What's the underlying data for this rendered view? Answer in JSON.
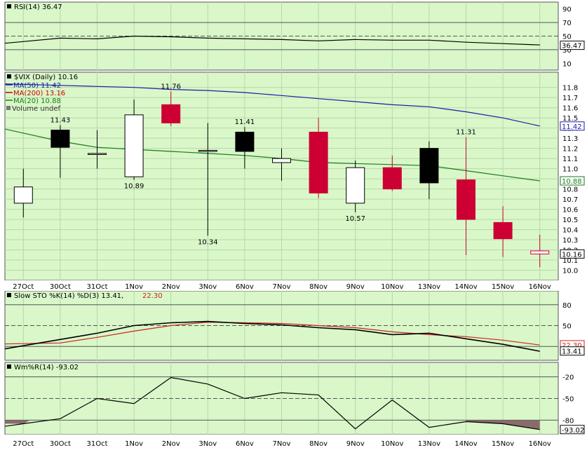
{
  "chart_data": [
    {
      "type": "line",
      "panel": "rsi",
      "title": "RSI(14) 36.47",
      "x": [
        "27Oct",
        "30Oct",
        "31Oct",
        "1Nov",
        "2Nov",
        "3Nov",
        "6Nov",
        "7Nov",
        "8Nov",
        "9Nov",
        "10Nov",
        "13Nov",
        "14Nov",
        "15Nov",
        "16Nov"
      ],
      "series": [
        {
          "name": "RSI(14)",
          "color": "#000000",
          "values": [
            42,
            47,
            46,
            50,
            49,
            47,
            46,
            45,
            43,
            45,
            44,
            44,
            41,
            39,
            37
          ]
        }
      ],
      "reference_lines": [
        70,
        50,
        30
      ],
      "yticks": [
        90,
        70,
        50,
        30,
        10
      ],
      "last_value_label": "36.47",
      "ylim": [
        0,
        100
      ]
    },
    {
      "type": "candlestick",
      "panel": "price",
      "title": "$VIX (Daily) 10.16",
      "categories": [
        "27Oct",
        "30Oct",
        "31Oct",
        "1Nov",
        "2Nov",
        "3Nov",
        "6Nov",
        "7Nov",
        "8Nov",
        "9Nov",
        "10Nov",
        "13Nov",
        "14Nov",
        "15Nov",
        "16Nov"
      ],
      "ohlc": [
        {
          "o": 10.66,
          "h": 11.0,
          "l": 10.52,
          "c": 10.82,
          "style": "hollow"
        },
        {
          "o": 11.38,
          "h": 11.43,
          "l": 10.91,
          "c": 11.21,
          "style": "black"
        },
        {
          "o": 11.15,
          "h": 11.38,
          "l": 11.0,
          "c": 11.15,
          "style": "hollow"
        },
        {
          "o": 10.92,
          "h": 11.68,
          "l": 10.89,
          "c": 11.53,
          "style": "hollow"
        },
        {
          "o": 11.45,
          "h": 11.76,
          "l": 11.42,
          "c": 11.63,
          "style": "red"
        },
        {
          "o": 11.18,
          "h": 11.45,
          "l": 10.34,
          "c": 11.17,
          "style": "hollow"
        },
        {
          "o": 11.36,
          "h": 11.41,
          "l": 11.0,
          "c": 11.17,
          "style": "black"
        },
        {
          "o": 11.06,
          "h": 11.2,
          "l": 10.88,
          "c": 11.1,
          "style": "hollow"
        },
        {
          "o": 11.36,
          "h": 11.5,
          "l": 10.71,
          "c": 10.76,
          "style": "red"
        },
        {
          "o": 10.66,
          "h": 11.08,
          "l": 10.57,
          "c": 11.01,
          "style": "hollow"
        },
        {
          "o": 11.01,
          "h": 11.13,
          "l": 10.78,
          "c": 10.8,
          "style": "red"
        },
        {
          "o": 11.2,
          "h": 11.27,
          "l": 10.7,
          "c": 10.86,
          "style": "black"
        },
        {
          "o": 10.89,
          "h": 11.31,
          "l": 10.15,
          "c": 10.5,
          "style": "red"
        },
        {
          "o": 10.47,
          "h": 10.63,
          "l": 10.13,
          "c": 10.31,
          "style": "red"
        },
        {
          "o": 10.19,
          "h": 10.35,
          "l": 10.03,
          "c": 10.16,
          "style": "red"
        }
      ],
      "series": [
        {
          "name": "MA(50) 11.42",
          "color": "#1a1aaa",
          "values": [
            11.83,
            11.82,
            11.81,
            11.8,
            11.78,
            11.77,
            11.75,
            11.72,
            11.69,
            11.66,
            11.63,
            11.61,
            11.56,
            11.5,
            11.42
          ]
        },
        {
          "name": "MA(200) 13.16",
          "color": "#cc0000",
          "values": []
        },
        {
          "name": "MA(20) 10.88",
          "color": "#1a7a1a",
          "values": [
            11.35,
            11.27,
            11.21,
            11.19,
            11.17,
            11.15,
            11.13,
            11.1,
            11.06,
            11.05,
            11.04,
            11.03,
            10.98,
            10.93,
            10.88
          ]
        }
      ],
      "legend_extra": "Volume undef",
      "data_labels": [
        {
          "i": 1,
          "text": "11.43",
          "pos": "high"
        },
        {
          "i": 3,
          "text": "10.89",
          "pos": "low"
        },
        {
          "i": 4,
          "text": "11.76",
          "pos": "high"
        },
        {
          "i": 5,
          "text": "10.34",
          "pos": "low"
        },
        {
          "i": 6,
          "text": "11.41",
          "pos": "high"
        },
        {
          "i": 9,
          "text": "10.57",
          "pos": "low"
        },
        {
          "i": 12,
          "text": "11.31",
          "pos": "high"
        }
      ],
      "yticks": [
        "11.8",
        "11.7",
        "11.6",
        "11.5",
        "11.4",
        "11.3",
        "11.2",
        "11.1",
        "11.0",
        "10.9",
        "10.8",
        "10.7",
        "10.6",
        "10.5",
        "10.4",
        "10.3",
        "10.2",
        "10.1",
        "10.0"
      ],
      "last_value_labels": [
        {
          "text": "11.42",
          "value": 11.42,
          "color": "#1a1aaa"
        },
        {
          "text": "10.88",
          "value": 10.88,
          "color": "#1a7a1a"
        },
        {
          "text": "10.16",
          "value": 10.16,
          "color": "#000000"
        }
      ],
      "ylim": [
        9.9,
        11.95
      ]
    },
    {
      "type": "line",
      "panel": "stochastic",
      "title": "Slow STO %K(14) %D(3) 13.41,",
      "title_d_value": "22.30",
      "series": [
        {
          "name": "%K",
          "color": "#000000",
          "values": [
            21,
            30,
            39,
            50,
            54,
            56,
            53,
            51,
            47,
            44,
            37,
            39,
            31,
            23,
            13
          ]
        },
        {
          "name": "%D",
          "color": "#cc2222",
          "values": [
            24,
            25,
            33,
            42,
            50,
            55,
            54,
            53,
            50,
            47,
            41,
            37,
            34,
            29,
            22
          ]
        }
      ],
      "reference_lines": [
        80,
        50,
        20
      ],
      "yticks": [
        80,
        50
      ],
      "last_value_labels": [
        {
          "text": "22.30",
          "color": "#cc2222"
        },
        {
          "text": "13.41",
          "color": "#000000"
        }
      ],
      "ylim": [
        0,
        100
      ]
    },
    {
      "type": "line",
      "panel": "williams",
      "title": "Wm%R(14) -93.02",
      "series": [
        {
          "name": "Wm%R(14)",
          "color": "#000000",
          "values": [
            -85,
            -78,
            -50,
            -57,
            -21,
            -30,
            -50,
            -42,
            -45,
            -92,
            -52,
            -90,
            -82,
            -85,
            -93
          ]
        }
      ],
      "reference_lines": [
        -20,
        -50,
        -80
      ],
      "yticks": [
        -20,
        -50,
        -80
      ],
      "last_value_label": "-93.02",
      "ylim": [
        -100,
        0
      ]
    }
  ],
  "x_axis_labels": [
    "27Oct",
    "30Oct",
    "31Oct",
    "1Nov",
    "2Nov",
    "3Nov",
    "6Nov",
    "7Nov",
    "8Nov",
    "9Nov",
    "10Nov",
    "13Nov",
    "14Nov",
    "15Nov",
    "16Nov"
  ]
}
